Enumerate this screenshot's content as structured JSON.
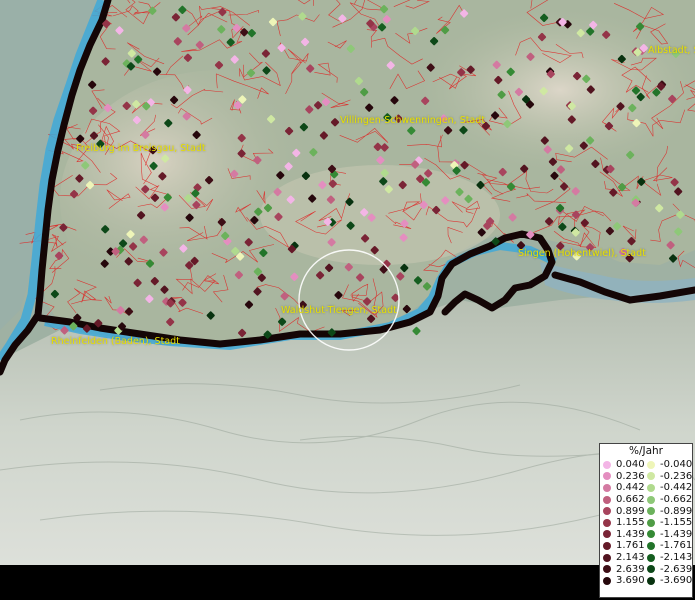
{
  "map": {
    "labels": [
      {
        "text": "Albstadt, S",
        "name": "label-albstadt"
      },
      {
        "text": "Villingen-Schwenningen, Stadt",
        "name": "label-villingen-schwenningen"
      },
      {
        "text": "Freiburg im Breisgau, Stadt",
        "name": "label-freiburg"
      },
      {
        "text": "Singen (Hohentwiel), Stadt",
        "name": "label-singen"
      },
      {
        "text": "Waldshut-Tiengen, Stadt",
        "name": "label-waldshut-tiengen"
      },
      {
        "text": "Rheinfelden (Baden), Stadt",
        "name": "label-rheinfelden"
      }
    ],
    "colors": {
      "border": "#1a0a0a",
      "river": "#3fa9d8",
      "district_lines": "#e02020",
      "land": "#a9b8a0",
      "lowland": "#b8c4b4",
      "alps": "#cdd3c9"
    }
  },
  "legend": {
    "title": "%/Jahr",
    "positive": [
      {
        "value": "0.040",
        "color": "#f3b5e6"
      },
      {
        "value": "0.236",
        "color": "#e48ec0"
      },
      {
        "value": "0.442",
        "color": "#d47aa2"
      },
      {
        "value": "0.662",
        "color": "#c0607f"
      },
      {
        "value": "0.899",
        "color": "#a8445e"
      },
      {
        "value": "1.155",
        "color": "#943448"
      },
      {
        "value": "1.439",
        "color": "#7a2436"
      },
      {
        "value": "1.761",
        "color": "#651a28"
      },
      {
        "value": "2.143",
        "color": "#521420"
      },
      {
        "value": "2.639",
        "color": "#3e0e16"
      },
      {
        "value": "3.690",
        "color": "#26070c"
      }
    ],
    "negative": [
      {
        "value": "-0.040",
        "color": "#eef5b8"
      },
      {
        "value": "-0.236",
        "color": "#cfe8a2"
      },
      {
        "value": "-0.442",
        "color": "#b0da8e"
      },
      {
        "value": "-0.662",
        "color": "#8ec878"
      },
      {
        "value": "-0.899",
        "color": "#6cb25c"
      },
      {
        "value": "-1.155",
        "color": "#4f9c45"
      },
      {
        "value": "-1.439",
        "color": "#358a35"
      },
      {
        "value": "-1.761",
        "color": "#22742a"
      },
      {
        "value": "-2.143",
        "color": "#155e20"
      },
      {
        "value": "-2.639",
        "color": "#0d4818"
      },
      {
        "value": "-3.690",
        "color": "#08320f"
      }
    ]
  }
}
